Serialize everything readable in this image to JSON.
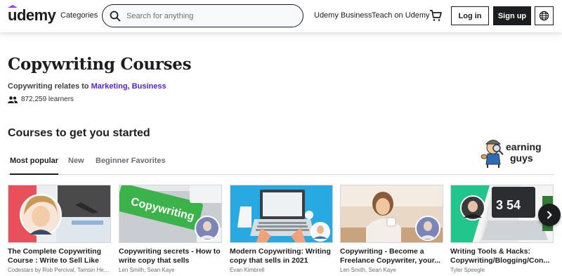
{
  "header": {
    "logo": "udemy",
    "categories": "Categories",
    "search_placeholder": "Search for anything",
    "udemy_business": "Udemy Business",
    "teach": "Teach on Udemy",
    "login": "Log in",
    "signup": "Sign up"
  },
  "topic": {
    "title": "Copywriting Courses",
    "relates_prefix": "Copywriting relates to",
    "relates_links": "Marketing, Business",
    "learners": "872,259 learners"
  },
  "section": {
    "title": "Courses to get you started",
    "tabs": [
      "Most popular",
      "New",
      "Beginner Favorites"
    ]
  },
  "watermark": {
    "line1": "earning",
    "line2": "guys"
  },
  "courses": [
    {
      "title": "The Complete Copywriting Course : Write to Sell Like a...",
      "author": "Codestars by Rob Percival, Tamsin Hen..."
    },
    {
      "title": "Copywriting secrets - How to write copy that sells",
      "author": "Len Smith, Sean Kaye",
      "thumb_text": "Copywriting"
    },
    {
      "title": "Modern Copywriting: Writing copy that sells in 2021",
      "author": "Evan Kimbrell"
    },
    {
      "title": "Copywriting - Become a Freelance Copywriter, your...",
      "author": "Len Smith, Sean Kaye"
    },
    {
      "title": "Writing Tools & Hacks: Copywriting/Blogging/Con...",
      "author": "Tyler Speegle",
      "thumb_text": "3 54"
    }
  ],
  "colors": {
    "accent": "#5624d0",
    "dark": "#1c1d1f"
  }
}
